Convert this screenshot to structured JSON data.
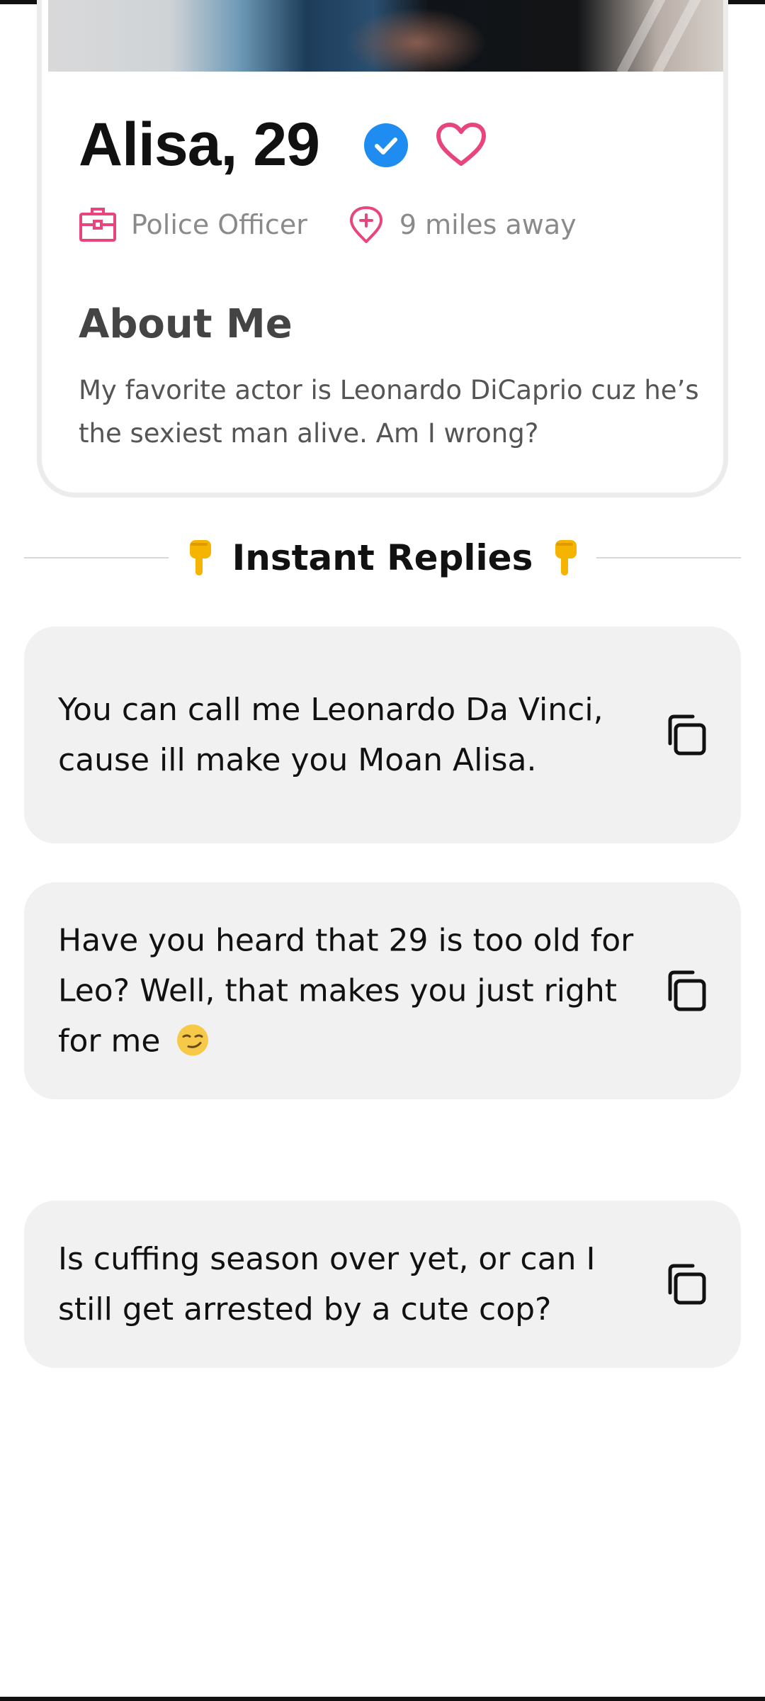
{
  "profile": {
    "name_age": "Alisa, 29",
    "job": "Police Officer",
    "distance": "9 miles away",
    "about_title": "About Me",
    "about_text": "My favorite actor is Leonardo DiCaprio cuz he’s the sexiest man alive. Am I wrong?",
    "verified_icon": "verified-check-icon",
    "like_icon": "heart-icon"
  },
  "section": {
    "title": "Instant Replies",
    "emoji": "pointing-down-emoji"
  },
  "replies": [
    {
      "text": "You can call me Leonardo Da Vinci, cause ill make you Moan Alisa.",
      "icon": "copy-icon"
    },
    {
      "text": "Have you heard that 29 is too old for Leo? Well, that makes you just right for me",
      "emoji": "smirking-face-emoji",
      "icon": "copy-icon"
    },
    {
      "text": "Is cuffing season over yet, or can I still get arrested by a cute cop?",
      "icon": "copy-icon"
    }
  ],
  "colors": {
    "accent_pink": "#e8457f",
    "verified_blue": "#1e8cf0",
    "card_bg": "#f1f1f2"
  }
}
